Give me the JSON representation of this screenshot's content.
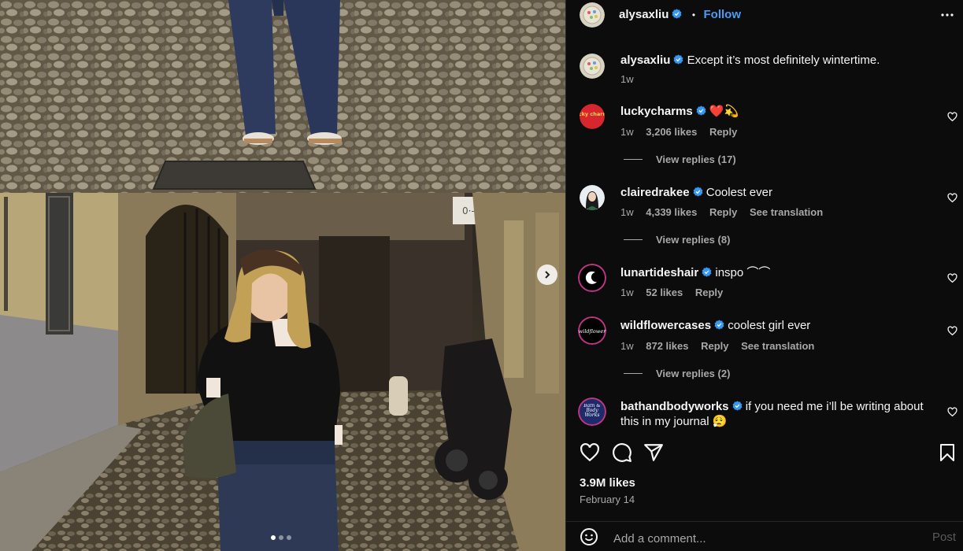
{
  "post": {
    "author": "alysaxliu",
    "follow_label": "Follow",
    "separator": "•",
    "caption": "Except it’s most definitely wintertime.",
    "caption_time": "1w",
    "likes": "3.9M likes",
    "date": "February 14",
    "carousel": {
      "current": 1,
      "total": 3
    }
  },
  "comments": [
    {
      "username": "luckycharms",
      "text": "❤️💫",
      "time": "1w",
      "likes": "3,206 likes",
      "reply": "Reply",
      "translation": "",
      "view_replies": "View replies (17)"
    },
    {
      "username": "clairedrakee",
      "text": "Coolest ever",
      "time": "1w",
      "likes": "4,339 likes",
      "reply": "Reply",
      "translation": "See translation",
      "view_replies": "View replies (8)"
    },
    {
      "username": "lunartideshair",
      "text": "inspo ⌒⌒",
      "time": "1w",
      "likes": "52 likes",
      "reply": "Reply",
      "translation": "",
      "view_replies": ""
    },
    {
      "username": "wildflowercases",
      "text": "coolest girl ever",
      "time": "1w",
      "likes": "872 likes",
      "reply": "Reply",
      "translation": "See translation",
      "view_replies": "View replies (2)"
    },
    {
      "username": "bathandbodyworks",
      "text": "if you need me i’ll be writing about this in my journal 😮‍💨",
      "time": "",
      "likes": "",
      "reply": "",
      "translation": "",
      "view_replies": ""
    }
  ],
  "avatar_text": {
    "luckycharms": "lucky charms",
    "wildflowercases": "wildflower",
    "bathandbodyworks": "Bath & Body Works"
  },
  "add_comment": {
    "placeholder": "Add a comment...",
    "post_label": "Post"
  },
  "icons": {
    "verified": "verified-badge-icon",
    "more": "more-options-icon",
    "like": "heart-icon",
    "comment": "comment-icon",
    "share": "share-icon",
    "save": "bookmark-icon",
    "emoji": "emoji-icon",
    "next": "chevron-right-icon"
  },
  "colors": {
    "link": "#4a9cf6",
    "verified": "#3897f0",
    "background": "#0c0c0c",
    "muted": "#a8a8a8"
  }
}
